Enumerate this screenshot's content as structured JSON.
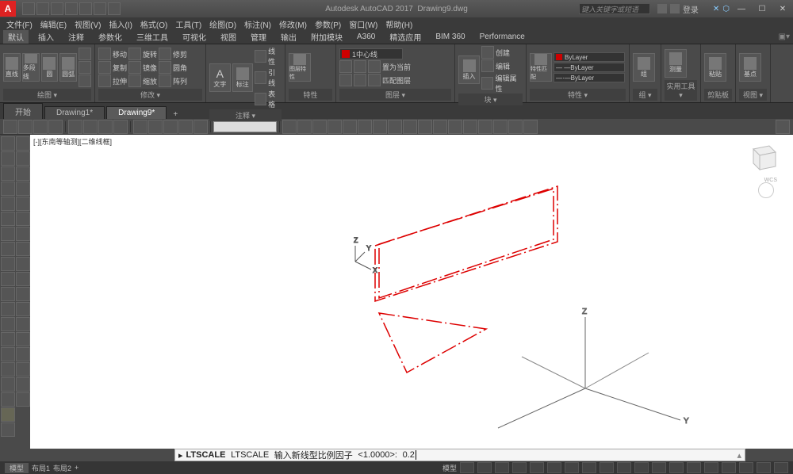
{
  "app": {
    "title_prefix": "Autodesk AutoCAD 2017",
    "current_file": "Drawing9.dwg",
    "search_placeholder": "键入关键字或短语",
    "user_label": "登录"
  },
  "menu": [
    "文件(F)",
    "编辑(E)",
    "视图(V)",
    "插入(I)",
    "格式(O)",
    "工具(T)",
    "绘图(D)",
    "标注(N)",
    "修改(M)",
    "参数(P)",
    "窗口(W)",
    "帮助(H)"
  ],
  "tabs": [
    "默认",
    "插入",
    "注释",
    "参数化",
    "三维工具",
    "可视化",
    "视图",
    "管理",
    "输出",
    "附加模块",
    "A360",
    "精选应用",
    "BIM 360",
    "Performance"
  ],
  "ribbon": {
    "draw": {
      "title": "绘图 ▾",
      "line": "直线",
      "polyline": "多段线",
      "circle": "圆",
      "arc": "圆弧"
    },
    "modify": {
      "title": "修改 ▾",
      "move": "移动",
      "copy": "复制",
      "stretch": "拉伸",
      "rotate": "旋转",
      "mirror": "镜像",
      "scale": "缩放",
      "trim": "修剪",
      "fillet": "圆角",
      "array": "阵列"
    },
    "annotation": {
      "title": "注释 ▾",
      "text": "文字",
      "dim": "标注",
      "linear": "线性",
      "leader": "引线",
      "table": "表格"
    },
    "layers": {
      "title": "图层 ▾",
      "props": "图层特性",
      "current_layer": "1中心线",
      "make_current": "置为当前",
      "match": "匹配图层"
    },
    "block": {
      "title": "块 ▾",
      "insert": "插入",
      "create": "创建",
      "edit": "编辑",
      "edit_attr": "编辑属性"
    },
    "properties": {
      "title": "特性 ▾",
      "match": "特性匹配",
      "layer_color": "ByLayer",
      "lt1": "ByLayer",
      "lt2": "ByLayer"
    },
    "group": {
      "title": "组 ▾",
      "group": "组"
    },
    "utilities": {
      "title": "实用工具 ▾",
      "measure": "测量"
    },
    "clipboard": {
      "title": "剪贴板",
      "paste": "粘贴"
    },
    "view": {
      "title": "视图 ▾",
      "base": "基点"
    }
  },
  "doctabs": {
    "items": [
      "开始",
      "Drawing1*",
      "Drawing9*"
    ],
    "active": 2
  },
  "viewport_label": "[-][东南等轴测][二维线框]",
  "command": {
    "name": "LTSCALE",
    "echo": "LTSCALE",
    "prompt": "输入新线型比例因子",
    "default": "<1.0000>:",
    "input": "0.2"
  },
  "status": {
    "model": "模型",
    "layout1": "布局1",
    "layout2": "布局2",
    "coords": "模型"
  },
  "axes": {
    "x": "X",
    "y": "Y",
    "z": "Z"
  },
  "wcs": "WCS"
}
